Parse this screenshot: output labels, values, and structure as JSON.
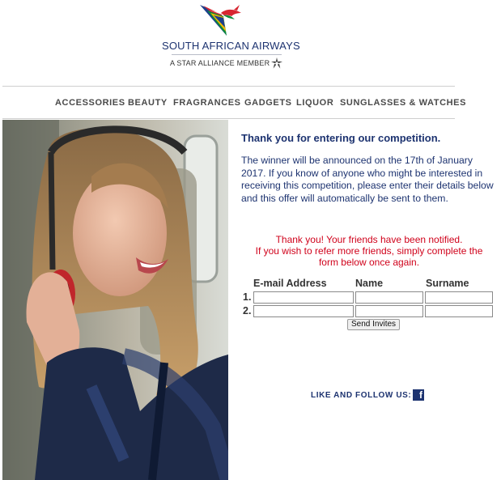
{
  "header": {
    "brand": "SOUTH AFRICAN AIRWAYS",
    "alliance": "A STAR ALLIANCE MEMBER",
    "logo_icon": "saa-flying-springbok-logo",
    "star_icon": "star-alliance-icon"
  },
  "nav": {
    "items": [
      {
        "label": "ACCESSORIES"
      },
      {
        "label": "BEAUTY"
      },
      {
        "label": "FRAGRANCES"
      },
      {
        "label": "GADGETS"
      },
      {
        "label": "LIQUOR"
      },
      {
        "label": "SUNGLASSES & WATCHES"
      }
    ]
  },
  "main": {
    "heading": "Thank you for entering our competition.",
    "message": "The winner will be announced on the 17th of January 2017. If you know of anyone who might be interested in receiving this competition, please enter their details below and this offer will automatically be sent to them.",
    "notice_line1": "Thank you! Your friends have been notified.",
    "notice_line2": "If you wish to refer more friends, simply complete the",
    "notice_line3": "form below once again."
  },
  "form": {
    "columns": [
      "E-mail Address",
      "Name",
      "Surname"
    ],
    "rows": [
      {
        "num": "1.",
        "email": "",
        "name": "",
        "surname": ""
      },
      {
        "num": "2.",
        "email": "",
        "name": "",
        "surname": ""
      }
    ],
    "submit_label": "Send Invites"
  },
  "social": {
    "follow_label": "LIKE AND FOLLOW US:",
    "facebook_icon": "facebook-icon",
    "facebook_glyph": "f"
  },
  "colors": {
    "navy": "#1d3370",
    "notice_red": "#d0021b"
  }
}
